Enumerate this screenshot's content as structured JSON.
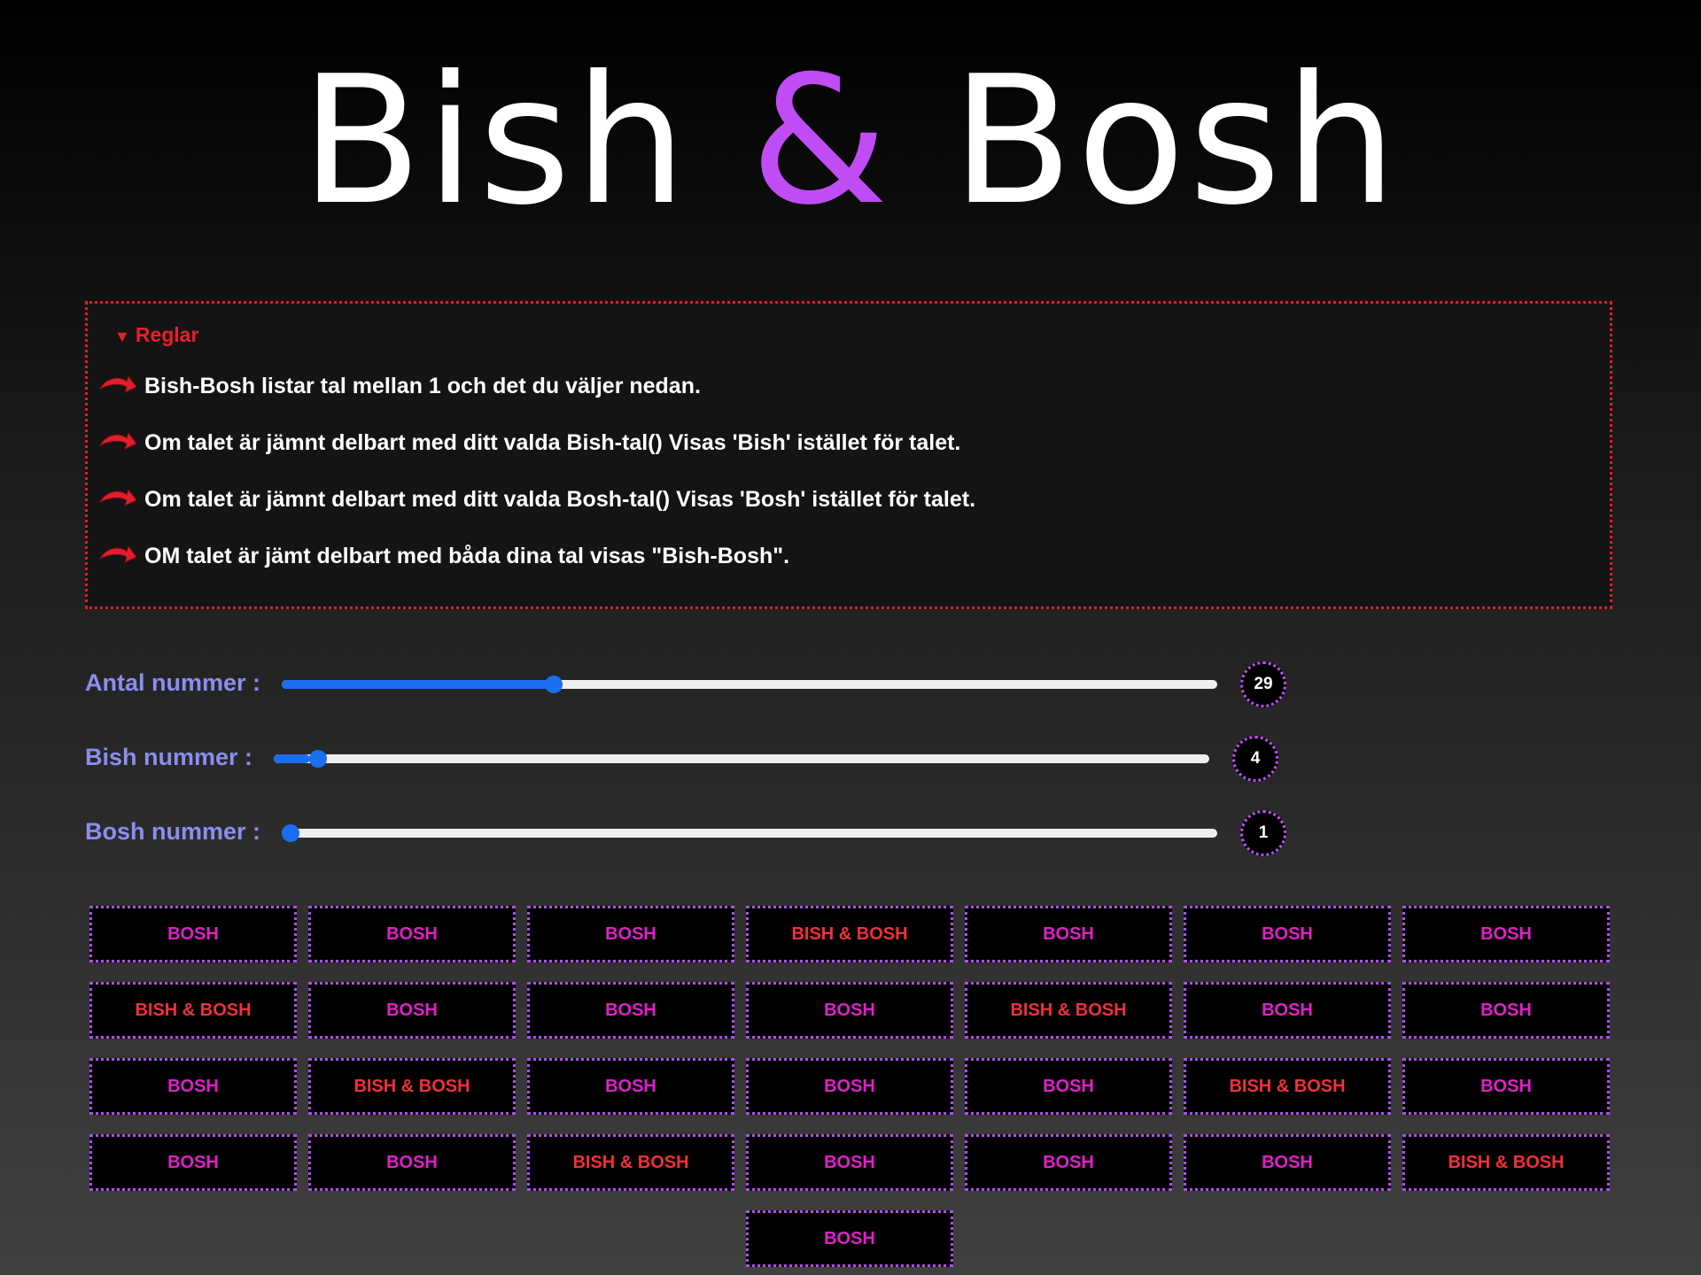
{
  "header": {
    "title_part1": "Bish",
    "title_amp": "&",
    "title_part2": "Bosh"
  },
  "rules": {
    "summary": "Reglar",
    "items": [
      "Bish-Bosh listar tal mellan 1 och det du väljer nedan.",
      "Om talet är jämnt delbart med ditt valda Bish-tal() Visas 'Bish' istället för talet.",
      "Om talet är jämnt delbart med ditt valda Bosh-tal() Visas 'Bosh' istället för talet.",
      "OM talet är jämt delbart med båda dina tal visas \"Bish-Bosh\"."
    ],
    "icon": "red-arrow-icon"
  },
  "sliders": [
    {
      "label": "Antal nummer :",
      "value": "29",
      "fraction": 0.287
    },
    {
      "label": "Bish nummer :",
      "value": "4",
      "fraction": 0.039
    },
    {
      "label": "Bosh nummer :",
      "value": "1",
      "fraction": 0.0
    }
  ],
  "results": [
    "BOSH",
    "BOSH",
    "BOSH",
    "BISH & BOSH",
    "BOSH",
    "BOSH",
    "BOSH",
    "BISH & BOSH",
    "BOSH",
    "BOSH",
    "BOSH",
    "BISH & BOSH",
    "BOSH",
    "BOSH",
    "BOSH",
    "BISH & BOSH",
    "BOSH",
    "BOSH",
    "BOSH",
    "BISH & BOSH",
    "BOSH",
    "BOSH",
    "BOSH",
    "BISH & BOSH",
    "BOSH",
    "BOSH",
    "BOSH",
    "BISH & BOSH",
    "BOSH"
  ],
  "colors": {
    "accent_purple": "#c04cf5",
    "rules_red": "#e01e2e",
    "label_blue": "#8a8ef0",
    "slider_blue": "#1a6ff0",
    "bosh_pink": "#e020c8",
    "bishbosh_red": "#f0303a"
  }
}
